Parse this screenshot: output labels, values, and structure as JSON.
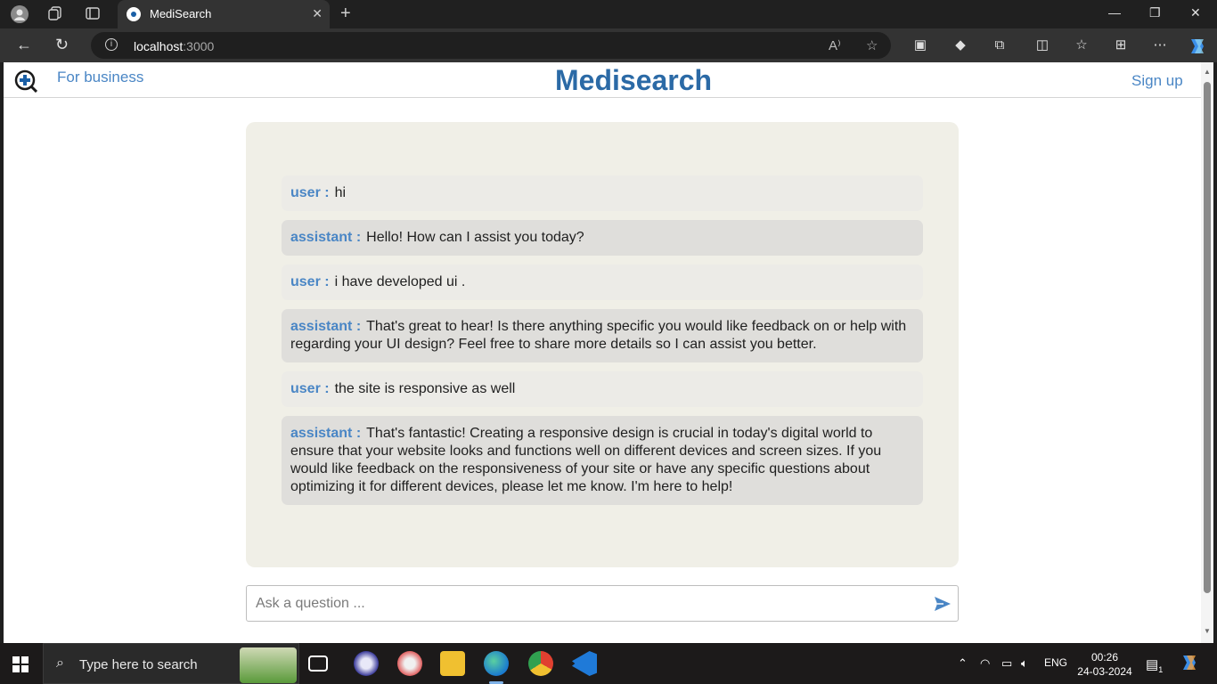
{
  "browser": {
    "tab_title": "MediSearch",
    "url_host": "localhost",
    "url_port": ":3000"
  },
  "header": {
    "for_business": "For business",
    "brand": "Medisearch",
    "signup": "Sign up"
  },
  "chat": {
    "messages": [
      {
        "role": "user :",
        "text": "hi"
      },
      {
        "role": "assistant :",
        "text": "Hello! How can I assist you today?"
      },
      {
        "role": "user :",
        "text": "i have developed ui ."
      },
      {
        "role": "assistant :",
        "text": "That's great to hear! Is there anything specific you would like feedback on or help with regarding your UI design? Feel free to share more details so I can assist you better."
      },
      {
        "role": "user :",
        "text": "the site is responsive as well"
      },
      {
        "role": "assistant :",
        "text": "That's fantastic! Creating a responsive design is crucial in today's digital world to ensure that your website looks and functions well on different devices and screen sizes. If you would like feedback on the responsiveness of your site or have any specific questions about optimizing it for different devices, please let me know. I'm here to help!"
      }
    ]
  },
  "input": {
    "placeholder": "Ask a question ..."
  },
  "taskbar": {
    "search_text": "Type here to search",
    "lang": "ENG",
    "time": "00:26",
    "date": "24-03-2024",
    "notification_count": "1"
  },
  "colors": {
    "brand": "#2b6aa6",
    "accent": "#4a86c5",
    "panel": "#f0efe7"
  }
}
